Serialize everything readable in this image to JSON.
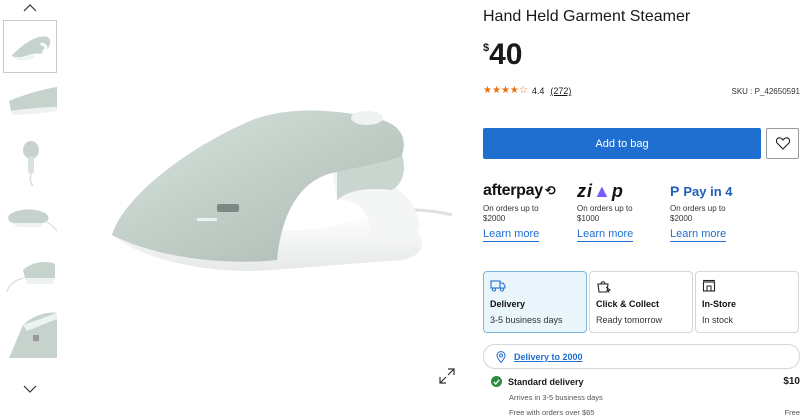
{
  "product": {
    "title": "Hand Held Garment Steamer",
    "currency_symbol": "$",
    "price": "40",
    "rating_value": "4.4",
    "rating_count": "(272)",
    "stars_filled": 4.4,
    "sku": "SKU : P_42650591"
  },
  "actions": {
    "add_to_bag": "Add to bag"
  },
  "payment_options": [
    {
      "provider": "afterpay",
      "desc_line1": "On orders up to",
      "desc_line2": "$2000",
      "learn": "Learn more"
    },
    {
      "provider": "zip",
      "desc_line1": "On orders up to",
      "desc_line2": "$1000",
      "learn": "Learn more"
    },
    {
      "provider": "paypal",
      "label": "Pay in 4",
      "desc_line1": "On orders up to",
      "desc_line2": "$2000",
      "learn": "Learn more"
    }
  ],
  "fulfilment": [
    {
      "title": "Delivery",
      "subtitle": "3-5 business days",
      "icon": "truck-icon",
      "selected": true
    },
    {
      "title": "Click & Collect",
      "subtitle": "Ready tomorrow",
      "icon": "click-collect-icon",
      "selected": false
    },
    {
      "title": "In-Store",
      "subtitle": "In stock",
      "icon": "store-icon",
      "selected": false
    }
  ],
  "delivery": {
    "to_label": "Delivery to 2000",
    "standard": {
      "name": "Standard delivery",
      "price": "$10",
      "eta": "Arrives in 3-5 business days",
      "free_note": "Free with orders over $65",
      "free_label": "Free"
    }
  },
  "colors": {
    "primary": "#1f6fd1",
    "star": "#e8710a",
    "selected_bg": "#eaf5fc",
    "selected_border": "#7ab8e0",
    "check": "#2e8b3d"
  },
  "icons": [
    "chevron-up-icon",
    "chevron-down-icon",
    "expand-icon",
    "heart-icon",
    "location-pin-icon",
    "check-icon",
    "truck-icon",
    "click-collect-icon",
    "store-icon"
  ]
}
